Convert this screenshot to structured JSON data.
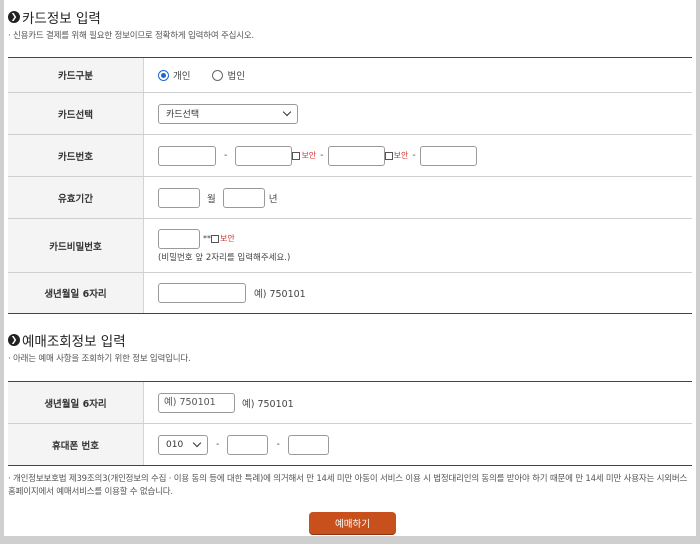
{
  "card_section": {
    "title": "카드정보 입력",
    "desc": "· 신용카드 결제를 위해 필요한 정보이므로 정확하게 입력하여 주십시오.",
    "card_type": {
      "label": "카드구분",
      "opt1": "개인",
      "opt2": "법인",
      "selected": "개인"
    },
    "card_select": {
      "label": "카드선택",
      "value": "카드선택"
    },
    "card_number": {
      "label": "카드번호",
      "dash": "-",
      "secure": "보안",
      "values": [
        "",
        "",
        "",
        ""
      ]
    },
    "expiry": {
      "label": "유효기간",
      "month_unit": "월",
      "year_unit": "년",
      "month": "",
      "year": ""
    },
    "password": {
      "label": "카드비밀번호",
      "suffix": "**",
      "secure": "보안",
      "hint": "(비밀번호 앞 2자리를 입력해주세요.)",
      "value": ""
    },
    "birth": {
      "label": "생년월일 6자리",
      "example": "예) 750101",
      "value": ""
    }
  },
  "reservation_section": {
    "title": "예매조회정보 입력",
    "desc": "· 아래는 예매 사항을 조회하기 위한 정보 입력입니다.",
    "birth": {
      "label": "생년월일 6자리",
      "placeholder": "예) 750101",
      "example": "예) 750101"
    },
    "phone": {
      "label": "휴대폰 번호",
      "prefix": "010",
      "dash": "-",
      "mid": "",
      "last": ""
    }
  },
  "notice": "· 개인정보보호법 제39조의3(개인정보의 수집 · 이용 동의 등에 대한 특례)에 의거해서 만 14세 미만 아동이 서비스 이용 시 법정대리인의 동의를 받아야 하기 때문에 만 14세 미만 사용자는 시외버스 홈페이지에서 예매서비스를 이용할 수 없습니다.",
  "submit_label": "예매하기",
  "colors": {
    "accent": "#c8501c",
    "radio": "#1a66d6",
    "secure": "#d03030"
  }
}
